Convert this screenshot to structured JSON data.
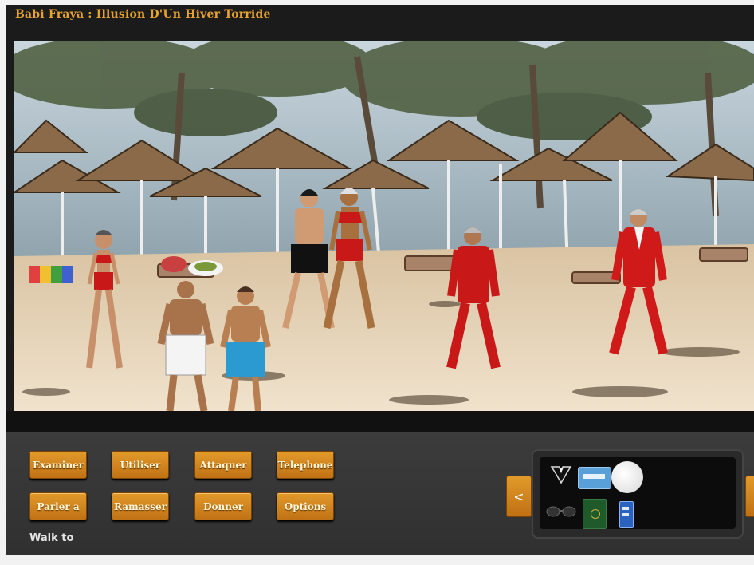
{
  "window": {
    "title": "Babi Fraya : Illusion D'Un Hiver Torride"
  },
  "verbs": [
    {
      "label": "Examiner"
    },
    {
      "label": "Utiliser"
    },
    {
      "label": "Attaquer"
    },
    {
      "label": "Telephone"
    },
    {
      "label": "Parler a"
    },
    {
      "label": "Ramasser"
    },
    {
      "label": "Donner"
    },
    {
      "label": "Options"
    }
  ],
  "status": {
    "text": "Walk to"
  },
  "inventory": {
    "scroll_left_label": "<",
    "scroll_right_label": ">",
    "items": [
      {
        "icon": "tuxedo-icon"
      },
      {
        "icon": "credit-card-icon"
      },
      {
        "icon": "white-ball-icon"
      },
      {
        "icon": "sunglasses-icon"
      },
      {
        "icon": "passport-icon"
      },
      {
        "icon": "phone-card-icon"
      }
    ]
  },
  "colors": {
    "accent": "#d98b1f",
    "title": "#e8a32c",
    "panel": "#333333",
    "background": "#1b1b1b"
  }
}
